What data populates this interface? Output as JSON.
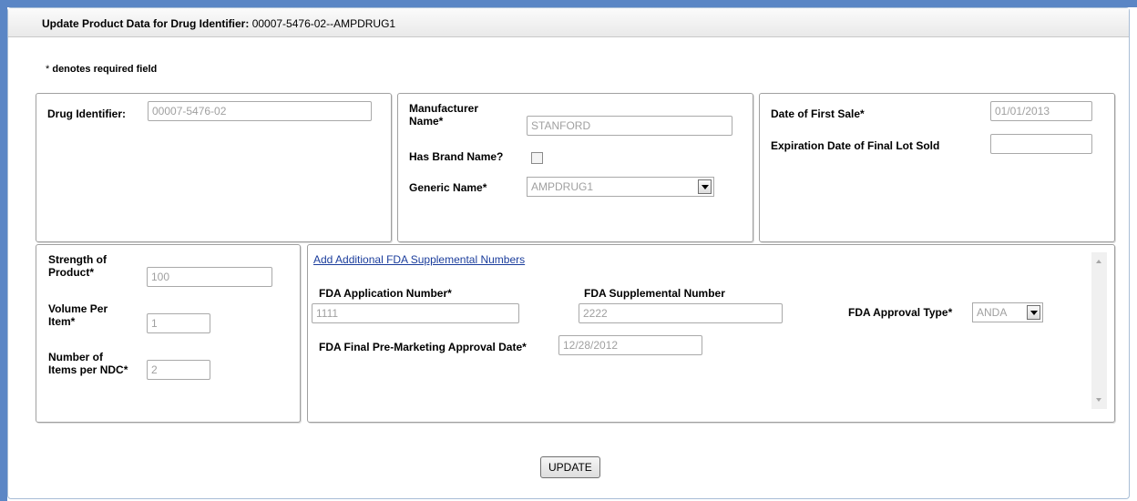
{
  "header": {
    "title_prefix": "Update Product Data for Drug Identifier:",
    "title_id": "00007-5476-02--AMPDRUG1"
  },
  "required_note": {
    "star": "*",
    "text": "denotes required field"
  },
  "drug_panel": {
    "drug_identifier_label": "Drug Identifier:",
    "drug_identifier_value": "00007-5476-02"
  },
  "manufacturer_panel": {
    "manufacturer_label_line1": "Manufacturer",
    "manufacturer_label_line2": "Name*",
    "manufacturer_value": "STANFORD",
    "has_brand_label": "Has Brand Name?",
    "has_brand_checked": false,
    "generic_label": "Generic Name*",
    "generic_value": "AMPDRUG1"
  },
  "dates_panel": {
    "first_sale_label": "Date of First Sale*",
    "first_sale_value": "01/01/2013",
    "expiration_label": "Expiration Date of Final Lot Sold",
    "expiration_value": ""
  },
  "strength_panel": {
    "strength_label_line1": "Strength of",
    "strength_label_line2": "Product*",
    "strength_value": "100",
    "volume_label_line1": "Volume Per",
    "volume_label_line2": "Item*",
    "volume_value": "1",
    "items_label_line1": "Number of",
    "items_label_line2": "Items per NDC*",
    "items_value": "2"
  },
  "fda_panel": {
    "add_link": "Add Additional FDA Supplemental Numbers",
    "app_number_label": "FDA Application Number*",
    "app_number_value": "1111",
    "supp_number_label": "FDA Supplemental Number",
    "supp_number_value": "2222",
    "approval_type_label": "FDA Approval Type*",
    "approval_type_value": "ANDA",
    "final_date_label": "FDA Final Pre-Marketing Approval Date*",
    "final_date_value": "12/28/2012"
  },
  "actions": {
    "update_label": "UPDATE"
  },
  "colors": {
    "frame_accent": "#5b86c5",
    "link": "#1b3d9c",
    "disabled_text": "#a0a0a0"
  }
}
